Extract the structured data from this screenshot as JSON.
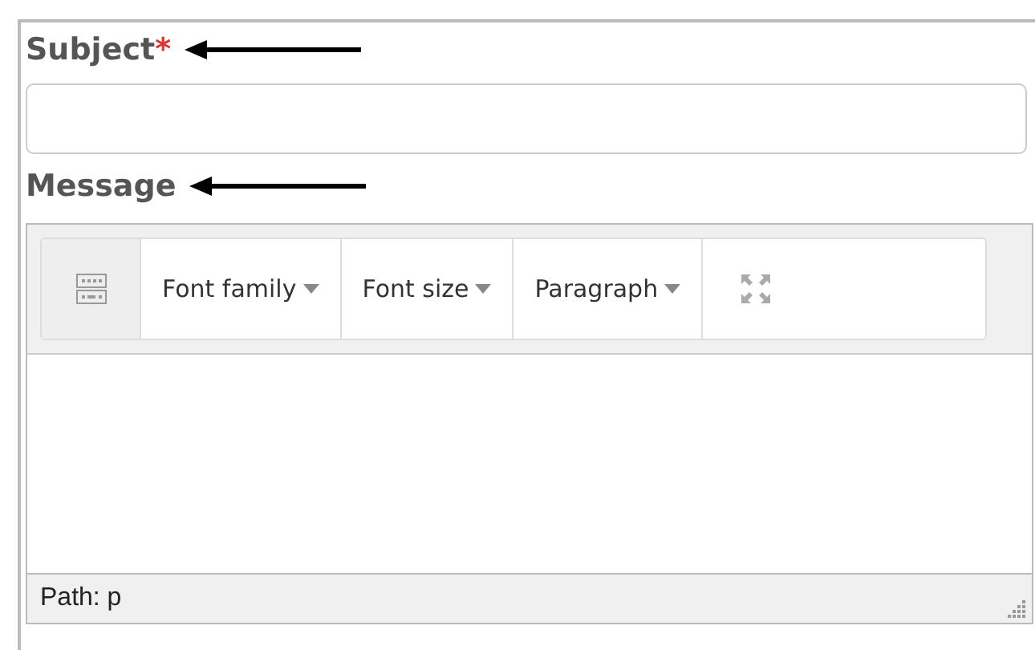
{
  "subject": {
    "label": "Subject",
    "required_mark": "*"
  },
  "message": {
    "label": "Message"
  },
  "toolbar": [
    {
      "kind": "toggle"
    },
    {
      "kind": "dropdown",
      "label": "Font family"
    },
    {
      "kind": "dropdown",
      "label": "Font size"
    },
    {
      "kind": "dropdown",
      "label": "Paragraph"
    },
    {
      "kind": "fullscreen"
    }
  ],
  "status_bar": {
    "path": "Path: p"
  }
}
